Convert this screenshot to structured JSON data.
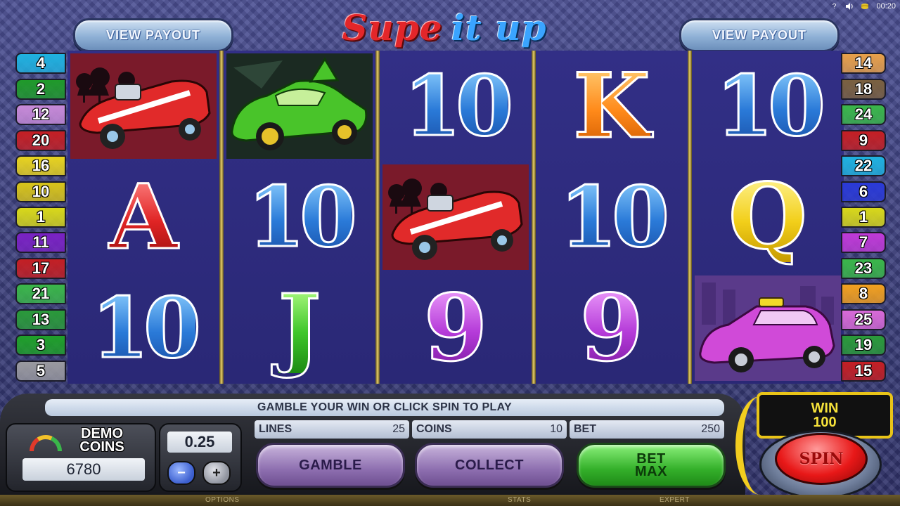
{
  "header": {
    "view_payout_left": "VIEW PAYOUT",
    "view_payout_right": "VIEW PAYOUT",
    "logo_part1": "Supe",
    "logo_part2": "it up",
    "clock": "00:20"
  },
  "reels": [
    [
      "car-red-hotrod",
      "A",
      "10"
    ],
    [
      "car-green-coupe",
      "10",
      "J"
    ],
    [
      "10",
      "car-red-hotrod",
      "9"
    ],
    [
      "K",
      "10",
      "9"
    ],
    [
      "10",
      "Q",
      "car-purple-taxi"
    ]
  ],
  "paylines_left": [
    "4",
    "2",
    "12",
    "20",
    "16",
    "10",
    "1",
    "11",
    "17",
    "21",
    "13",
    "3",
    "5"
  ],
  "paylines_right": [
    "14",
    "18",
    "24",
    "9",
    "22",
    "6",
    "1",
    "7",
    "23",
    "8",
    "25",
    "19",
    "15"
  ],
  "paylines_left_colors": [
    "#1fb2e0",
    "#1f9a2a",
    "#c78ad8",
    "#c41f24",
    "#e8d31f",
    "#d8c41a",
    "#d8d81a",
    "#7a22c4",
    "#c41f24",
    "#3ab64a",
    "#2a9a3a",
    "#1fa02a",
    "#9a9aa0"
  ],
  "paylines_right_colors": [
    "#e7a04a",
    "#7a6040",
    "#3ab64a",
    "#c41f24",
    "#1fb2e0",
    "#2a3ad8",
    "#d8d81a",
    "#c03ad8",
    "#3ab64a",
    "#f2a01f",
    "#d86ad8",
    "#2a9a3a",
    "#c41f24"
  ],
  "message": "GAMBLE YOUR WIN OR CLICK SPIN TO PLAY",
  "stats": {
    "lines_label": "LINES",
    "lines_value": "25",
    "coins_label": "COINS",
    "coins_value": "10",
    "bet_label": "BET",
    "bet_value": "250"
  },
  "buttons": {
    "gamble": "GAMBLE",
    "collect": "COLLECT",
    "bet_max_line1": "BET",
    "bet_max_line2": "MAX",
    "spin": "SPIN"
  },
  "balance": {
    "label_line1": "DEMO",
    "label_line2": "COINS",
    "value": "6780"
  },
  "denomination": {
    "value": "0.25",
    "minus": "−",
    "plus": "+"
  },
  "win": {
    "label": "WIN",
    "value": "100"
  },
  "footer": {
    "options": "OPTIONS",
    "stats": "STATS",
    "expert": "EXPERT"
  },
  "colors": {
    "reel_bg": "#2c2a7c",
    "gold_divider": "#e9cf6a",
    "win_border": "#e9c418"
  }
}
